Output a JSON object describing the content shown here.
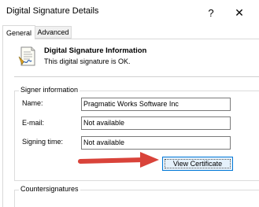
{
  "window": {
    "title": "Digital Signature Details",
    "help_symbol": "?",
    "close_symbol": "✕"
  },
  "tabs": [
    {
      "label": "General",
      "selected": true
    },
    {
      "label": "Advanced",
      "selected": false
    }
  ],
  "signature_info": {
    "icon": "signed-document-icon",
    "title": "Digital Signature Information",
    "status": "This digital signature is OK."
  },
  "signer": {
    "group_label": "Signer information",
    "fields": [
      {
        "label": "Name:",
        "value": "Pragmatic Works Software Inc"
      },
      {
        "label": "E-mail:",
        "value": "Not available"
      },
      {
        "label": "Signing time:",
        "value": "Not available"
      }
    ],
    "view_certificate_label": "View Certificate"
  },
  "countersignatures": {
    "group_label": "Countersignatures"
  },
  "colors": {
    "arrow": "#d9433a",
    "button_border": "#0078d7",
    "button_fill": "#e5f1fb"
  }
}
